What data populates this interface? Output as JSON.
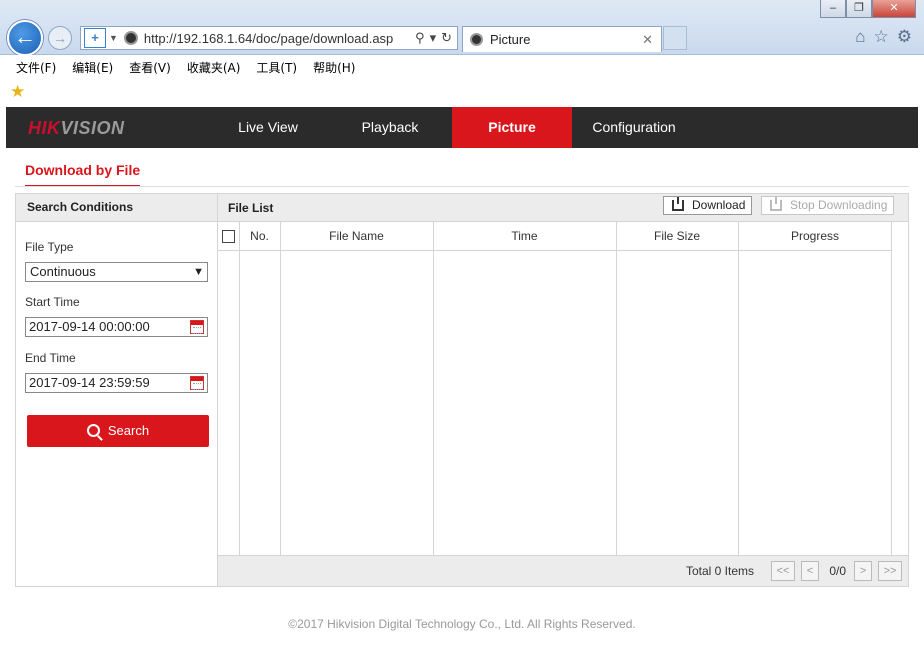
{
  "browser": {
    "url": "http://192.168.1.64/doc/page/download.asp",
    "tab_title": "Picture",
    "menu": [
      "文件(F)",
      "编辑(E)",
      "查看(V)",
      "收藏夹(A)",
      "工具(T)",
      "帮助(H)"
    ],
    "window_controls": {
      "minimize": "–",
      "restore": "❐",
      "close": "✕"
    }
  },
  "app": {
    "brand_a": "HIK",
    "brand_b": "VISION",
    "nav": [
      "Live View",
      "Playback",
      "Picture",
      "Configuration"
    ],
    "active_nav": "Picture",
    "subtab": "Download by File",
    "search": {
      "title": "Search Conditions",
      "file_type_label": "File Type",
      "file_type_value": "Continuous",
      "start_label": "Start Time",
      "start_value": "2017-09-14 00:00:00",
      "end_label": "End Time",
      "end_value": "2017-09-14 23:59:59",
      "button": "Search"
    },
    "file_list": {
      "title": "File List",
      "download_btn": "Download",
      "stop_btn": "Stop Downloading",
      "columns": [
        "No.",
        "File Name",
        "Time",
        "File Size",
        "Progress"
      ],
      "rows": [],
      "total": "Total 0 Items",
      "pager": {
        "first": "<<",
        "prev": "<",
        "info": "0/0",
        "next": ">",
        "last": ">>"
      }
    },
    "copyright": "©2017 Hikvision Digital Technology Co., Ltd. All Rights Reserved."
  }
}
